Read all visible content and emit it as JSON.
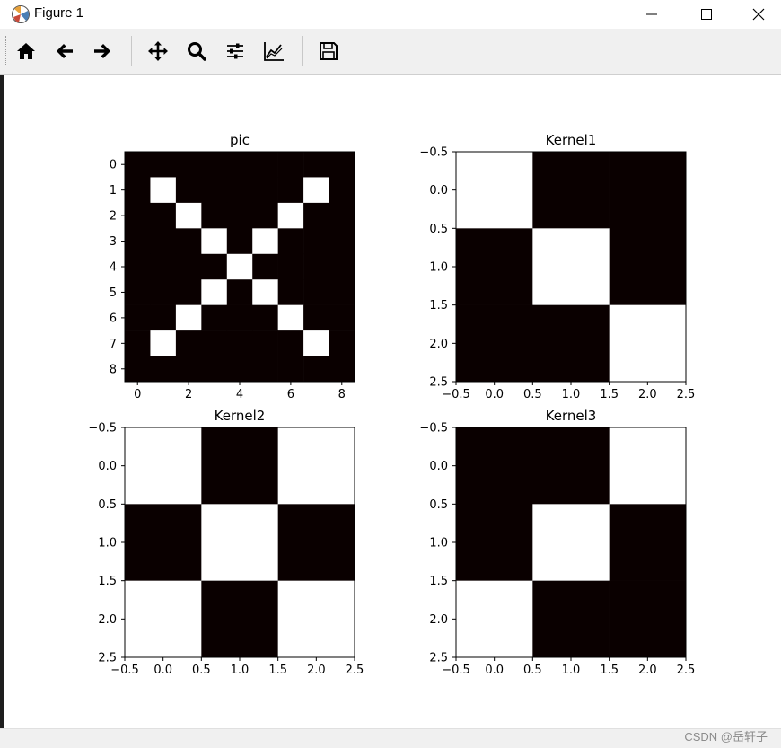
{
  "window": {
    "title": "Figure 1",
    "controls": [
      "minimize-icon",
      "maximize-icon",
      "close-icon"
    ]
  },
  "toolbar": {
    "items": [
      {
        "name": "home-button",
        "icon": "home-icon"
      },
      {
        "name": "back-button",
        "icon": "arrow-left-icon"
      },
      {
        "name": "forward-button",
        "icon": "arrow-right-icon"
      },
      {
        "name": "pan-button",
        "icon": "move-icon"
      },
      {
        "name": "zoom-button",
        "icon": "magnifier-icon"
      },
      {
        "name": "configure-subplots-button",
        "icon": "sliders-icon"
      },
      {
        "name": "edit-axes-button",
        "icon": "line-chart-icon"
      },
      {
        "name": "save-button",
        "icon": "floppy-disk-icon"
      }
    ]
  },
  "colors": {
    "on": "#ffffff",
    "off": "#0a0000"
  },
  "chart_data": [
    {
      "type": "heatmap",
      "title": "pic",
      "grid": false,
      "xticks": [
        "0",
        "2",
        "4",
        "6",
        "8"
      ],
      "yticks": [
        "0",
        "1",
        "2",
        "3",
        "4",
        "5",
        "6",
        "7",
        "8"
      ],
      "values": [
        [
          0,
          0,
          0,
          0,
          0,
          0,
          0,
          0,
          0
        ],
        [
          0,
          1,
          0,
          0,
          0,
          0,
          0,
          1,
          0
        ],
        [
          0,
          0,
          1,
          0,
          0,
          0,
          1,
          0,
          0
        ],
        [
          0,
          0,
          0,
          1,
          0,
          1,
          0,
          0,
          0
        ],
        [
          0,
          0,
          0,
          0,
          1,
          0,
          0,
          0,
          0
        ],
        [
          0,
          0,
          0,
          1,
          0,
          1,
          0,
          0,
          0
        ],
        [
          0,
          0,
          1,
          0,
          0,
          0,
          1,
          0,
          0
        ],
        [
          0,
          1,
          0,
          0,
          0,
          0,
          0,
          1,
          0
        ],
        [
          0,
          0,
          0,
          0,
          0,
          0,
          0,
          0,
          0
        ]
      ]
    },
    {
      "type": "heatmap",
      "title": "Kernel1",
      "grid": false,
      "xticks": [
        "−0.5",
        "0.0",
        "0.5",
        "1.0",
        "1.5",
        "2.0",
        "2.5"
      ],
      "yticks": [
        "−0.5",
        "0.0",
        "0.5",
        "1.0",
        "1.5",
        "2.0",
        "2.5"
      ],
      "values": [
        [
          1,
          0,
          0
        ],
        [
          0,
          1,
          0
        ],
        [
          0,
          0,
          1
        ]
      ]
    },
    {
      "type": "heatmap",
      "title": "Kernel2",
      "grid": false,
      "xticks": [
        "−0.5",
        "0.0",
        "0.5",
        "1.0",
        "1.5",
        "2.0",
        "2.5"
      ],
      "yticks": [
        "−0.5",
        "0.0",
        "0.5",
        "1.0",
        "1.5",
        "2.0",
        "2.5"
      ],
      "values": [
        [
          1,
          0,
          1
        ],
        [
          0,
          1,
          0
        ],
        [
          1,
          0,
          1
        ]
      ]
    },
    {
      "type": "heatmap",
      "title": "Kernel3",
      "grid": false,
      "xticks": [
        "−0.5",
        "0.0",
        "0.5",
        "1.0",
        "1.5",
        "2.0",
        "2.5"
      ],
      "yticks": [
        "−0.5",
        "0.0",
        "0.5",
        "1.0",
        "1.5",
        "2.0",
        "2.5"
      ],
      "values": [
        [
          0,
          0,
          1
        ],
        [
          0,
          1,
          0
        ],
        [
          1,
          0,
          0
        ]
      ]
    }
  ],
  "watermark": "CSDN @岳轩子"
}
